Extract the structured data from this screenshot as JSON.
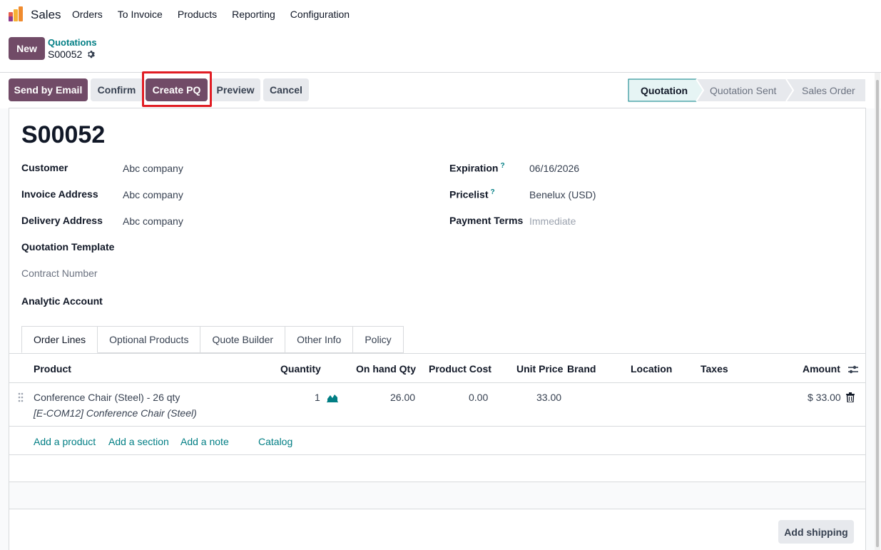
{
  "navbar": {
    "app_name": "Sales",
    "menu": [
      "Orders",
      "To Invoice",
      "Products",
      "Reporting",
      "Configuration"
    ]
  },
  "control_panel": {
    "new_label": "New",
    "breadcrumb": "Quotations",
    "record": "S00052"
  },
  "actions": {
    "send_by_email": "Send by Email",
    "confirm": "Confirm",
    "create_pq": "Create PQ",
    "preview": "Preview",
    "cancel": "Cancel"
  },
  "status": {
    "stages": [
      "Quotation",
      "Quotation Sent",
      "Sales Order"
    ],
    "active": "Quotation"
  },
  "form": {
    "title": "S00052",
    "customer_label": "Customer",
    "customer": "Abc company",
    "invoice_label": "Invoice Address",
    "invoice": "Abc company",
    "delivery_label": "Delivery Address",
    "delivery": "Abc company",
    "template_label": "Quotation Template",
    "contract_label": "Contract Number",
    "analytic_label": "Analytic Account",
    "expiration_label": "Expiration",
    "expiration": "06/16/2026",
    "pricelist_label": "Pricelist",
    "pricelist": "Benelux (USD)",
    "payment_label": "Payment Terms",
    "payment": "Immediate",
    "help_mark": "?"
  },
  "tabs": [
    "Order Lines",
    "Optional Products",
    "Quote Builder",
    "Other Info",
    "Policy"
  ],
  "table": {
    "headers": {
      "product": "Product",
      "quantity": "Quantity",
      "onhand": "On hand Qty",
      "cost": "Product Cost",
      "unit_price": "Unit Price",
      "brand": "Brand",
      "location": "Location",
      "taxes": "Taxes",
      "amount": "Amount"
    },
    "rows": [
      {
        "product": "Conference Chair (Steel) - 26 qty",
        "description": "[E-COM12] Conference Chair (Steel)",
        "quantity": "1",
        "onhand": "26.00",
        "cost": "0.00",
        "unit_price": "33.00",
        "amount": "$ 33.00"
      }
    ],
    "add_links": {
      "product": "Add a product",
      "section": "Add a section",
      "note": "Add a note",
      "catalog": "Catalog"
    }
  },
  "add_shipping": "Add shipping",
  "colors": {
    "primary": "#714b67",
    "accent": "#017e84",
    "highlight": "#e11d24"
  }
}
